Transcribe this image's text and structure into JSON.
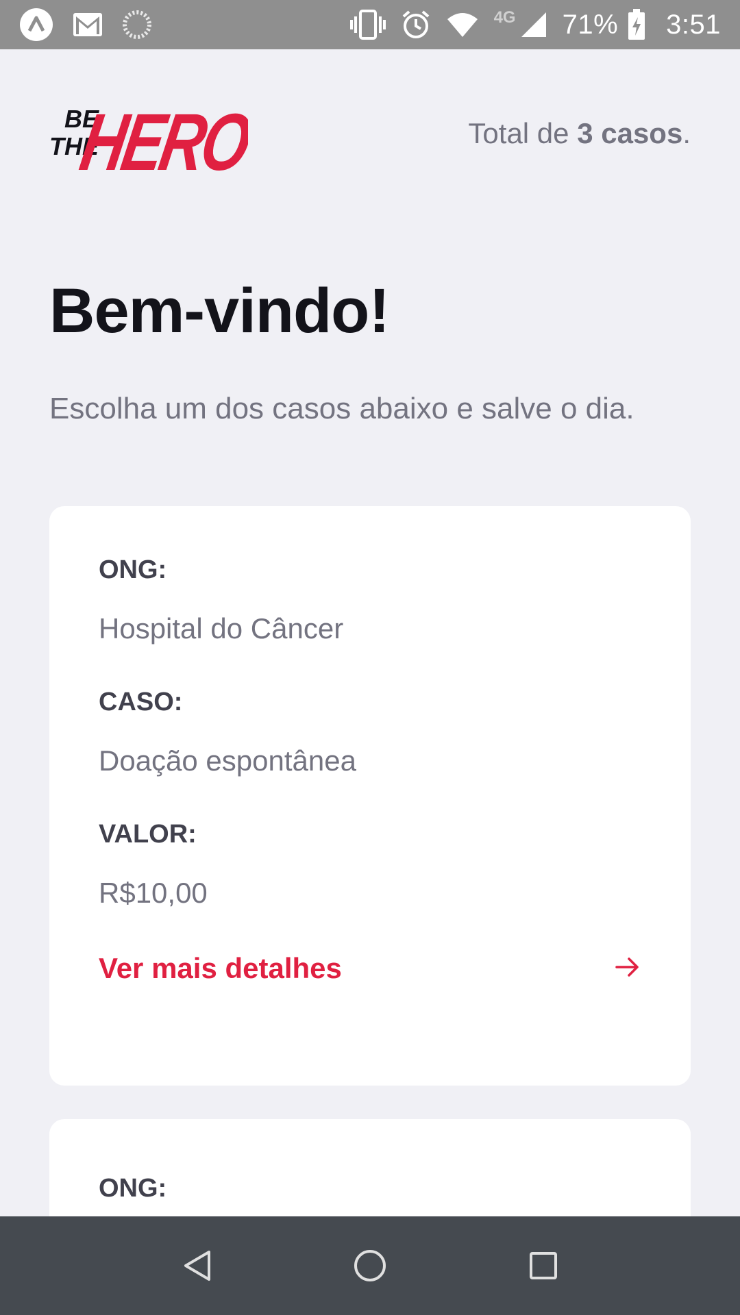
{
  "status_bar": {
    "battery": "71%",
    "time": "3:51",
    "network": "4G",
    "icons_left": [
      "app-notification-icon",
      "gmail-icon",
      "sync-icon"
    ],
    "icons_right": [
      "vibrate-icon",
      "alarm-icon",
      "wifi-icon",
      "signal-icon",
      "battery-charging-icon"
    ]
  },
  "header": {
    "logo_line1": "BE",
    "logo_line2": "THE",
    "logo_main": "HERO",
    "total_prefix": "Total de ",
    "total_count": "3 casos",
    "total_suffix": "."
  },
  "title": "Bem-vindo!",
  "description": "Escolha um dos casos abaixo e salve o dia.",
  "incidents": [
    {
      "ong_label": "ONG:",
      "ong_value": "Hospital do Câncer",
      "case_label": "CASO:",
      "case_value": "Doação espontânea",
      "value_label": "VALOR:",
      "value_value": "R$10,00",
      "details_label": "Ver mais detalhes"
    },
    {
      "ong_label": "ONG:"
    }
  ],
  "colors": {
    "brand_red": "#e02041",
    "background": "#f0f0f5",
    "text_dark": "#13131a",
    "text_muted": "#737380",
    "label_dark": "#41414d",
    "status_bar": "#8f8f8f",
    "nav_bar": "#454a50"
  },
  "nav_bar": {
    "buttons": [
      "back-icon",
      "home-icon",
      "recents-icon"
    ]
  }
}
